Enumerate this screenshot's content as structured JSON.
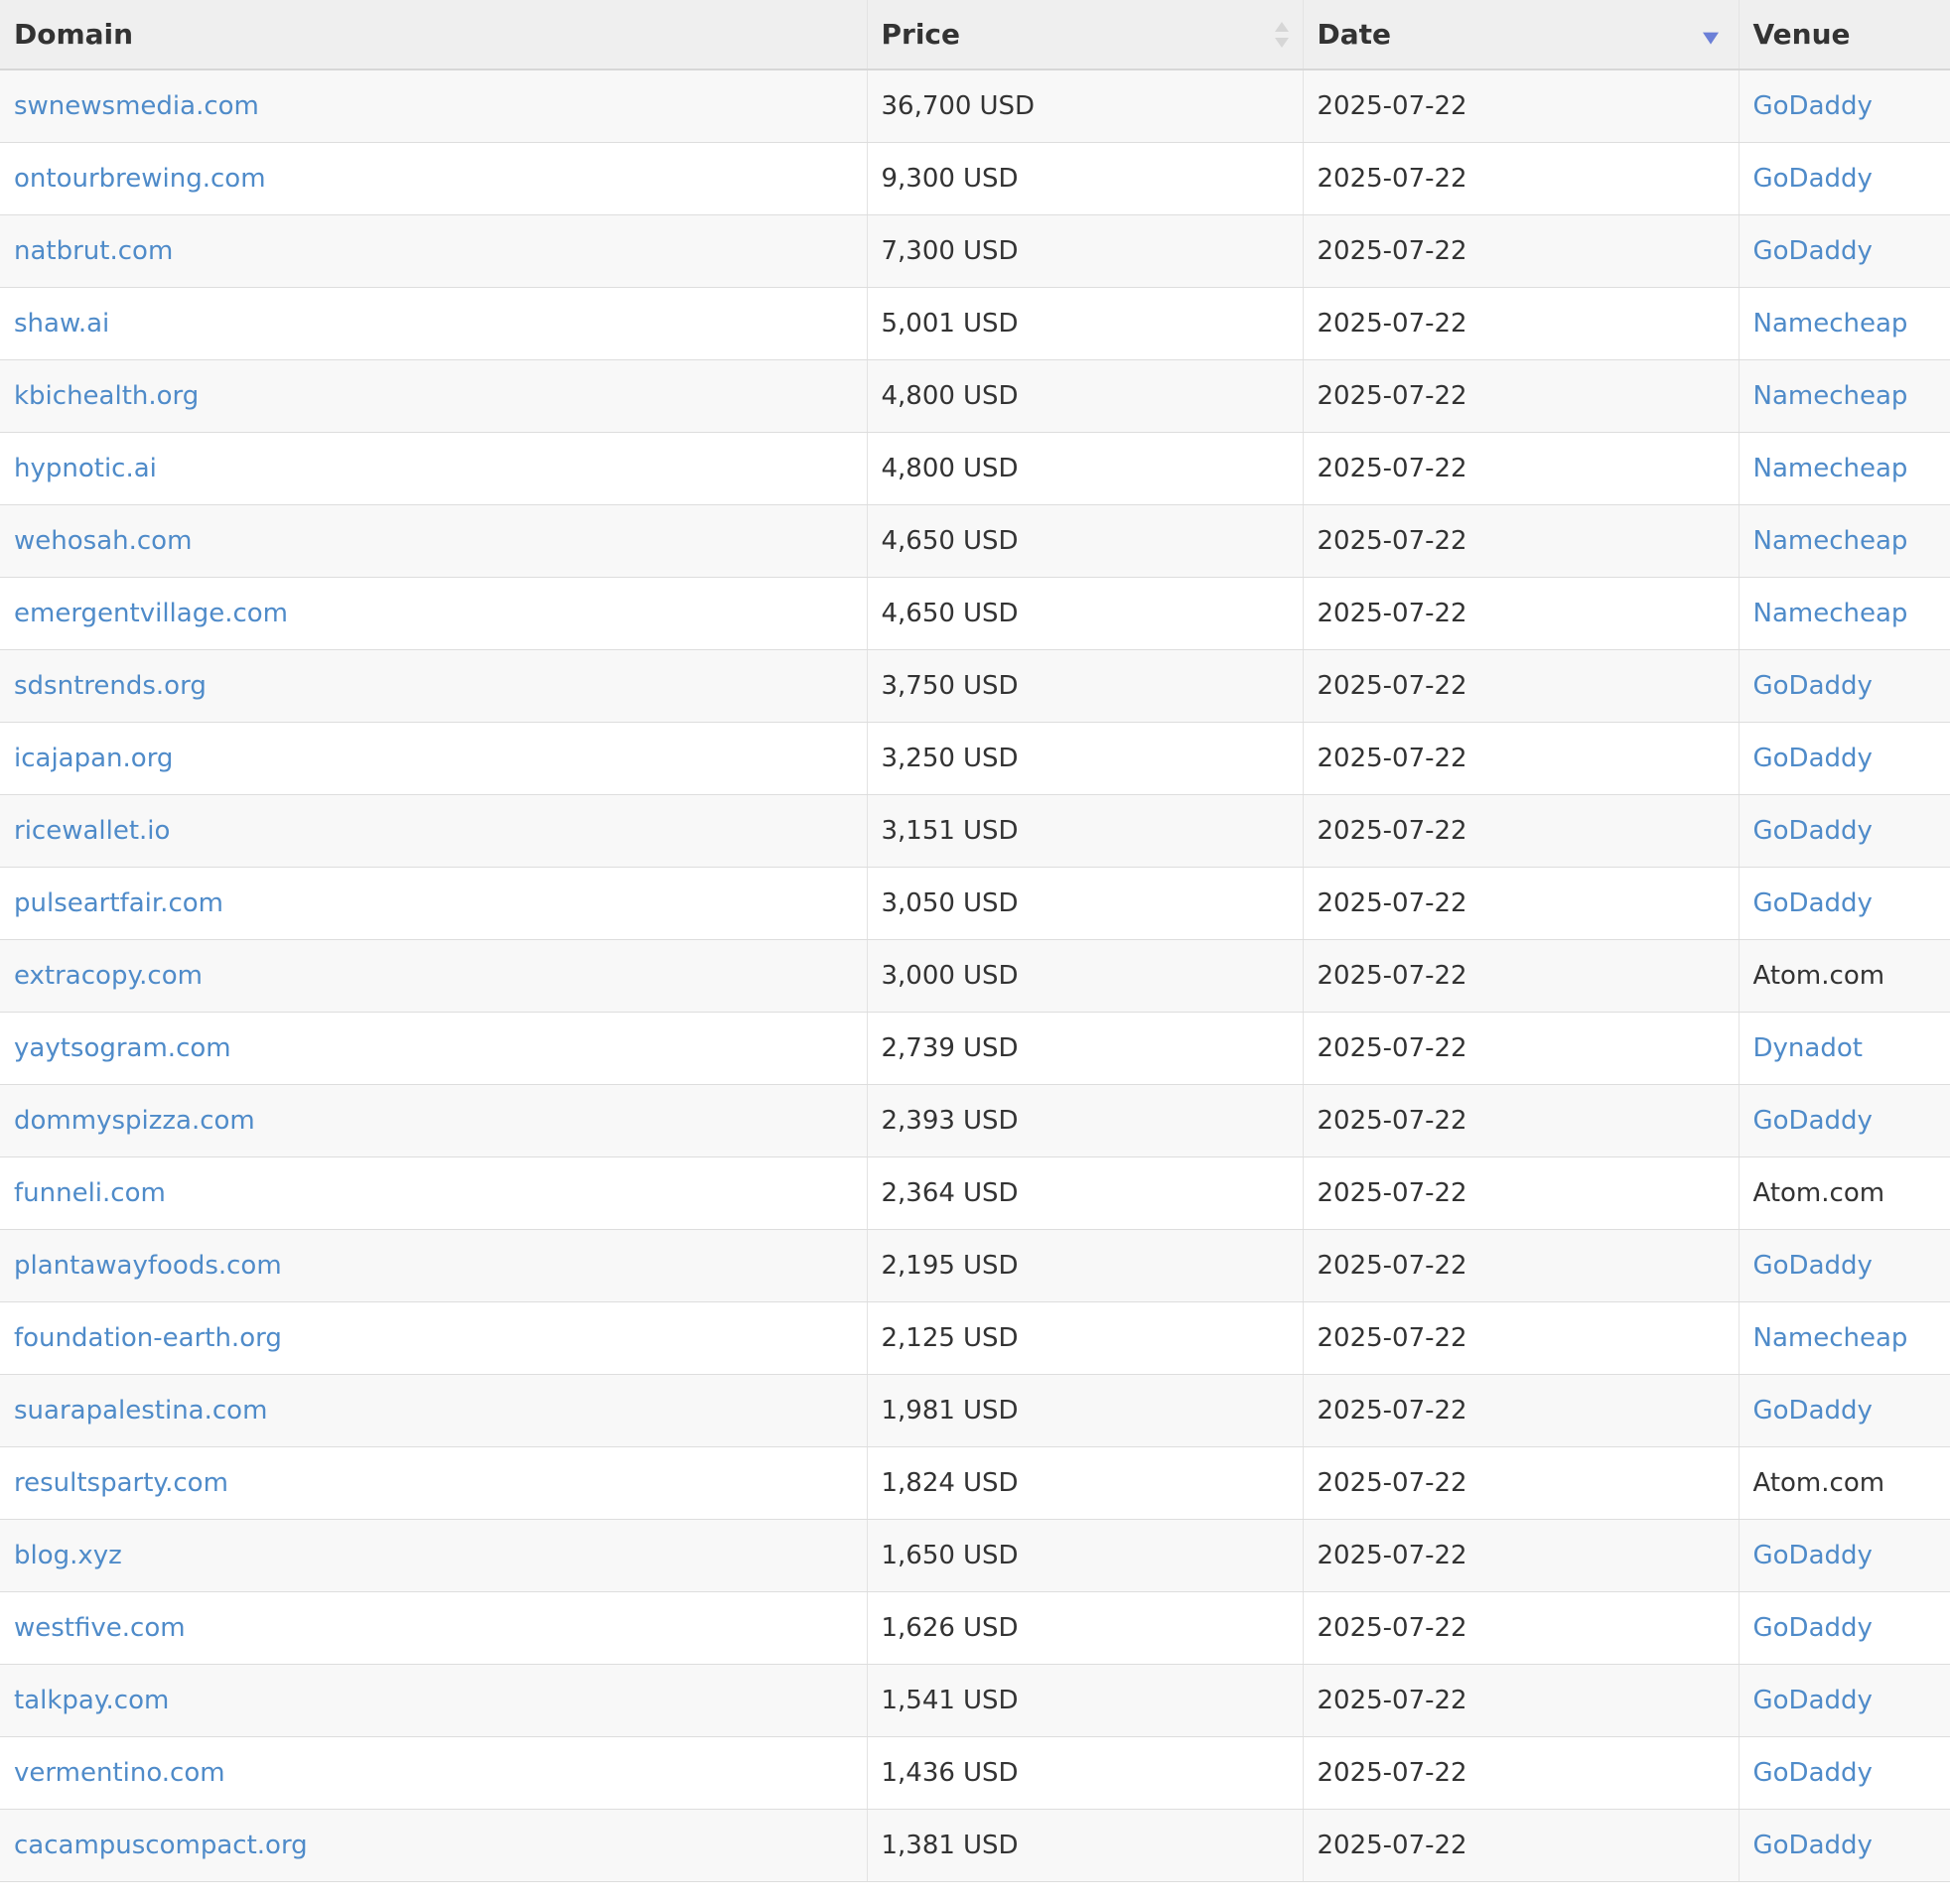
{
  "table": {
    "headers": {
      "domain": "Domain",
      "price": "Price",
      "date": "Date",
      "venue": "Venue"
    },
    "sort": {
      "price": "sortable",
      "date": "descending"
    },
    "colors": {
      "link": "#4f8bc9",
      "sort_active": "#6b7fd7"
    },
    "icons": {
      "price_sort": "sort-both-icon",
      "date_sort": "sort-descending-icon"
    },
    "rows": [
      {
        "domain": "swnewsmedia.com",
        "price": "36,700",
        "currency": "USD",
        "date": "2025-07-22",
        "venue": "GoDaddy",
        "venue_link": true
      },
      {
        "domain": "ontourbrewing.com",
        "price": "9,300",
        "currency": "USD",
        "date": "2025-07-22",
        "venue": "GoDaddy",
        "venue_link": true
      },
      {
        "domain": "natbrut.com",
        "price": "7,300",
        "currency": "USD",
        "date": "2025-07-22",
        "venue": "GoDaddy",
        "venue_link": true
      },
      {
        "domain": "shaw.ai",
        "price": "5,001",
        "currency": "USD",
        "date": "2025-07-22",
        "venue": "Namecheap",
        "venue_link": true
      },
      {
        "domain": "kbichealth.org",
        "price": "4,800",
        "currency": "USD",
        "date": "2025-07-22",
        "venue": "Namecheap",
        "venue_link": true
      },
      {
        "domain": "hypnotic.ai",
        "price": "4,800",
        "currency": "USD",
        "date": "2025-07-22",
        "venue": "Namecheap",
        "venue_link": true
      },
      {
        "domain": "wehosah.com",
        "price": "4,650",
        "currency": "USD",
        "date": "2025-07-22",
        "venue": "Namecheap",
        "venue_link": true
      },
      {
        "domain": "emergentvillage.com",
        "price": "4,650",
        "currency": "USD",
        "date": "2025-07-22",
        "venue": "Namecheap",
        "venue_link": true
      },
      {
        "domain": "sdsntrends.org",
        "price": "3,750",
        "currency": "USD",
        "date": "2025-07-22",
        "venue": "GoDaddy",
        "venue_link": true
      },
      {
        "domain": "icajapan.org",
        "price": "3,250",
        "currency": "USD",
        "date": "2025-07-22",
        "venue": "GoDaddy",
        "venue_link": true
      },
      {
        "domain": "ricewallet.io",
        "price": "3,151",
        "currency": "USD",
        "date": "2025-07-22",
        "venue": "GoDaddy",
        "venue_link": true
      },
      {
        "domain": "pulseartfair.com",
        "price": "3,050",
        "currency": "USD",
        "date": "2025-07-22",
        "venue": "GoDaddy",
        "venue_link": true
      },
      {
        "domain": "extracopy.com",
        "price": "3,000",
        "currency": "USD",
        "date": "2025-07-22",
        "venue": "Atom.com",
        "venue_link": false
      },
      {
        "domain": "yaytsogram.com",
        "price": "2,739",
        "currency": "USD",
        "date": "2025-07-22",
        "venue": "Dynadot",
        "venue_link": true
      },
      {
        "domain": "dommyspizza.com",
        "price": "2,393",
        "currency": "USD",
        "date": "2025-07-22",
        "venue": "GoDaddy",
        "venue_link": true
      },
      {
        "domain": "funneli.com",
        "price": "2,364",
        "currency": "USD",
        "date": "2025-07-22",
        "venue": "Atom.com",
        "venue_link": false
      },
      {
        "domain": "plantawayfoods.com",
        "price": "2,195",
        "currency": "USD",
        "date": "2025-07-22",
        "venue": "GoDaddy",
        "venue_link": true
      },
      {
        "domain": "foundation-earth.org",
        "price": "2,125",
        "currency": "USD",
        "date": "2025-07-22",
        "venue": "Namecheap",
        "venue_link": true
      },
      {
        "domain": "suarapalestina.com",
        "price": "1,981",
        "currency": "USD",
        "date": "2025-07-22",
        "venue": "GoDaddy",
        "venue_link": true
      },
      {
        "domain": "resultsparty.com",
        "price": "1,824",
        "currency": "USD",
        "date": "2025-07-22",
        "venue": "Atom.com",
        "venue_link": false
      },
      {
        "domain": "blog.xyz",
        "price": "1,650",
        "currency": "USD",
        "date": "2025-07-22",
        "venue": "GoDaddy",
        "venue_link": true
      },
      {
        "domain": "westfive.com",
        "price": "1,626",
        "currency": "USD",
        "date": "2025-07-22",
        "venue": "GoDaddy",
        "venue_link": true
      },
      {
        "domain": "talkpay.com",
        "price": "1,541",
        "currency": "USD",
        "date": "2025-07-22",
        "venue": "GoDaddy",
        "venue_link": true
      },
      {
        "domain": "vermentino.com",
        "price": "1,436",
        "currency": "USD",
        "date": "2025-07-22",
        "venue": "GoDaddy",
        "venue_link": true
      },
      {
        "domain": "cacampuscompact.org",
        "price": "1,381",
        "currency": "USD",
        "date": "2025-07-22",
        "venue": "GoDaddy",
        "venue_link": true
      }
    ]
  }
}
